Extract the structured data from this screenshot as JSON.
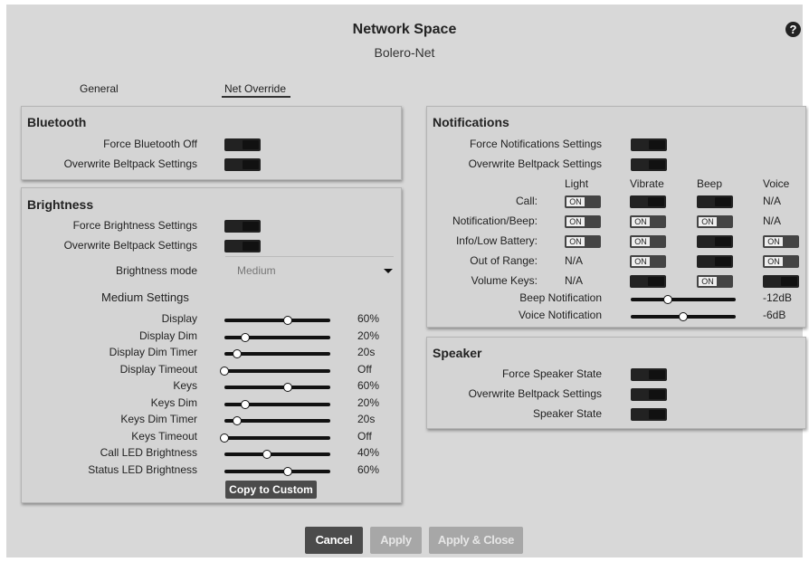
{
  "header": {
    "title": "Network Space",
    "subtitle": "Bolero-Net",
    "help_icon": "?"
  },
  "tabs": [
    {
      "label": "General"
    },
    {
      "label": "Net Override",
      "active": true
    }
  ],
  "bluetooth": {
    "title": "Bluetooth",
    "rows": [
      {
        "label": "Force Bluetooth Off",
        "state": "off"
      },
      {
        "label": "Overwrite Beltpack Settings",
        "state": "off"
      }
    ]
  },
  "brightness": {
    "title": "Brightness",
    "rows": [
      {
        "label": "Force Brightness Settings",
        "state": "off"
      },
      {
        "label": "Overwrite Beltpack Settings",
        "state": "off"
      }
    ],
    "mode_label": "Brightness mode",
    "mode_value": "Medium",
    "section_title": "Medium Settings",
    "sliders": [
      {
        "label": "Display",
        "value": "60%",
        "level": 0.6
      },
      {
        "label": "Display Dim",
        "value": "20%",
        "level": 0.2
      },
      {
        "label": "Display Dim Timer",
        "value": "20s",
        "level": 0.12
      },
      {
        "label": "Display Timeout",
        "value": "Off",
        "level": 0.0
      },
      {
        "label": "Keys",
        "value": "60%",
        "level": 0.6
      },
      {
        "label": "Keys Dim",
        "value": "20%",
        "level": 0.2
      },
      {
        "label": "Keys Dim Timer",
        "value": "20s",
        "level": 0.12
      },
      {
        "label": "Keys Timeout",
        "value": "Off",
        "level": 0.0
      },
      {
        "label": "Call LED Brightness",
        "value": "40%",
        "level": 0.4
      },
      {
        "label": "Status LED Brightness",
        "value": "60%",
        "level": 0.6
      }
    ],
    "copy_button": "Copy to Custom"
  },
  "notifications": {
    "title": "Notifications",
    "rows": [
      {
        "label": "Force Notifications Settings",
        "state": "off"
      },
      {
        "label": "Overwrite Beltpack Settings",
        "state": "off"
      }
    ],
    "columns": [
      "Light",
      "Vibrate",
      "Beep",
      "Voice"
    ],
    "on_text": "ON",
    "na_text": "N/A",
    "grid": [
      {
        "label": "Call:",
        "cells": [
          "on",
          "off",
          "off",
          "N/A"
        ]
      },
      {
        "label": "Notification/Beep:",
        "cells": [
          "on",
          "on",
          "on",
          "N/A"
        ]
      },
      {
        "label": "Info/Low Battery:",
        "cells": [
          "on",
          "on",
          "off",
          "on"
        ]
      },
      {
        "label": "Out of Range:",
        "cells": [
          "N/A",
          "on",
          "off",
          "on"
        ]
      },
      {
        "label": "Volume Keys:",
        "cells": [
          "N/A",
          "off",
          "on",
          "off"
        ]
      }
    ],
    "sliders": [
      {
        "label": "Beep Notification",
        "value": "-12dB",
        "level": 0.35
      },
      {
        "label": "Voice Notification",
        "value": "-6dB",
        "level": 0.5
      }
    ]
  },
  "speaker": {
    "title": "Speaker",
    "rows": [
      {
        "label": "Force Speaker State",
        "state": "off"
      },
      {
        "label": "Overwrite Beltpack Settings",
        "state": "off"
      },
      {
        "label": "Speaker State",
        "state": "off"
      }
    ]
  },
  "footer": {
    "cancel": "Cancel",
    "apply": "Apply",
    "apply_close": "Apply & Close"
  }
}
